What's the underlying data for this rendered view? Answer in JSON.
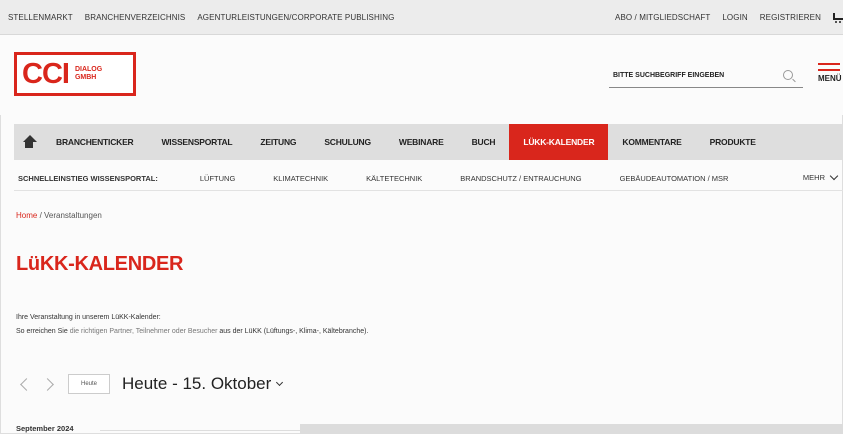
{
  "topbar": {
    "left": [
      "STELLENMARKT",
      "BRANCHENVERZEICHNIS",
      "AGENTURLEISTUNGEN/CORPORATE PUBLISHING"
    ],
    "right": [
      "ABO / MITGLIEDSCHAFT",
      "LOGIN",
      "REGISTRIEREN"
    ]
  },
  "logo": {
    "brand": "CCI",
    "sub_line1": "DIALOG",
    "sub_line2": "GMBH"
  },
  "search": {
    "placeholder": "BITTE SUCHBEGRIFF EINGEBEN"
  },
  "menu": {
    "label": "MENÜ"
  },
  "mainnav": {
    "items": [
      "BRANCHENTICKER",
      "WISSENSPORTAL",
      "ZEITUNG",
      "SCHULUNG",
      "WEBINARE",
      "BUCH",
      "LÜKK-KALENDER",
      "KOMMENTARE",
      "PRODUKTE"
    ],
    "active": "LÜKK-KALENDER"
  },
  "quicknav": {
    "label": "SCHNELLEINSTIEG WISSENSPORTAL:",
    "items": [
      "LÜFTUNG",
      "KLIMATECHNIK",
      "KÄLTETECHNIK",
      "BRANDSCHUTZ / ENTRAUCHUNG",
      "GEBÄUDEAUTOMATION / MSR"
    ],
    "more": "MEHR"
  },
  "breadcrumb": {
    "home": "Home",
    "separator": " / ",
    "current": "Veranstaltungen"
  },
  "page": {
    "title": "LüKK-KALENDER",
    "intro_line1": "Ihre Veranstaltung in unserem LüKK-Kalender:",
    "intro_line2_a": "So erreichen Sie ",
    "intro_line2_b": "die richtigen Partner, Teilnehmer oder Besucher",
    "intro_line2_c": " aus der LüKK (Lüftungs-, Klima-, Kältebranche)."
  },
  "calendar": {
    "today_button": "Heute",
    "heading": "Heute - 15. Oktober",
    "month_label": "September 2024"
  },
  "colors": {
    "accent": "#d9261c",
    "nav_bg": "#dedede"
  }
}
